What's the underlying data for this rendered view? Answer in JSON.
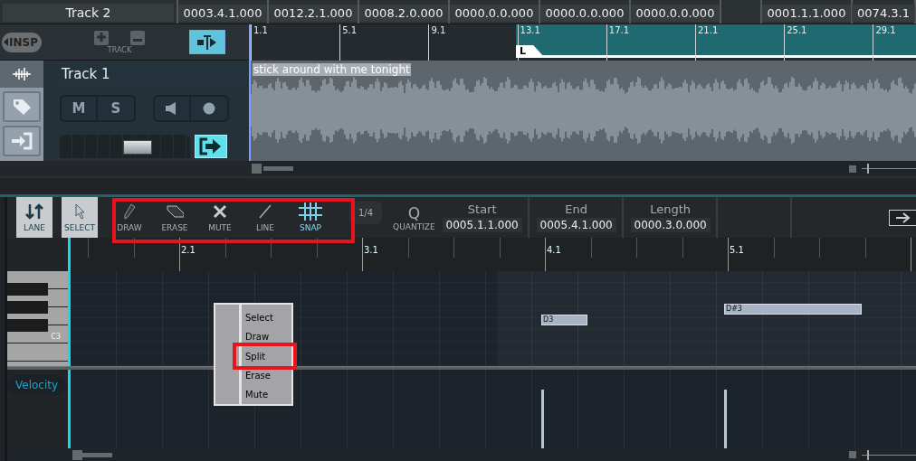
{
  "header_fields": [
    {
      "value": "Track 2"
    },
    {
      "value": "0003.4.1.000"
    },
    {
      "value": "0012.2.1.000"
    },
    {
      "value": "0008.2.0.000"
    },
    {
      "value": "0000.0.0.000"
    },
    {
      "value": "0000.0.0.000"
    },
    {
      "value": "0000.0.0.000"
    },
    {
      "value": "0001.1.1.000"
    },
    {
      "value": "0074.3.1"
    }
  ],
  "arrange_toolbar": {
    "insp_button": "INSP",
    "track_label": "TRACK"
  },
  "arrange_ruler": {
    "marks": [
      "1.1",
      "5.1",
      "9.1",
      "13.1",
      "17.1",
      "21.1",
      "25.1",
      "29.1"
    ],
    "loop_marker": "L"
  },
  "track": {
    "name": "Track 1",
    "mute_label": "M",
    "solo_label": "S",
    "fader": {
      "level": 0.6
    },
    "clip_title": "stick around with me tonight"
  },
  "editor_toolbar": {
    "tools": [
      {
        "label": "LANE",
        "selected": true
      },
      {
        "label": "SELECT",
        "selected": true
      },
      {
        "label": "DRAW",
        "selected": false
      },
      {
        "label": "ERASE",
        "selected": false
      },
      {
        "label": "MUTE",
        "selected": false
      },
      {
        "label": "LINE",
        "selected": false
      }
    ],
    "snap": {
      "label": "SNAP",
      "on": true
    },
    "grid": "1/4",
    "quantize_glyph": "Q",
    "quantize_label": "QUANTIZE",
    "fields": [
      {
        "label": "Start",
        "value": "0005.1.1.000"
      },
      {
        "label": "End",
        "value": "0005.4.1.000"
      },
      {
        "label": "Length",
        "value": "0000.3.0.000"
      }
    ]
  },
  "editor_ruler": {
    "marks": [
      "2.1",
      "3.1",
      "4.1",
      "5.1"
    ]
  },
  "arrange_zoom": {
    "level": 0.1
  },
  "editor_zoom": {
    "level": 0.1
  },
  "piano": {
    "key_label": "C3"
  },
  "notes": [
    {
      "label": "D3"
    },
    {
      "label": "D#3"
    }
  ],
  "context_menu": {
    "items": [
      "Select",
      "Draw",
      "Split",
      "Erase",
      "Mute"
    ]
  },
  "velocity_lane": {
    "label": "Velocity"
  }
}
